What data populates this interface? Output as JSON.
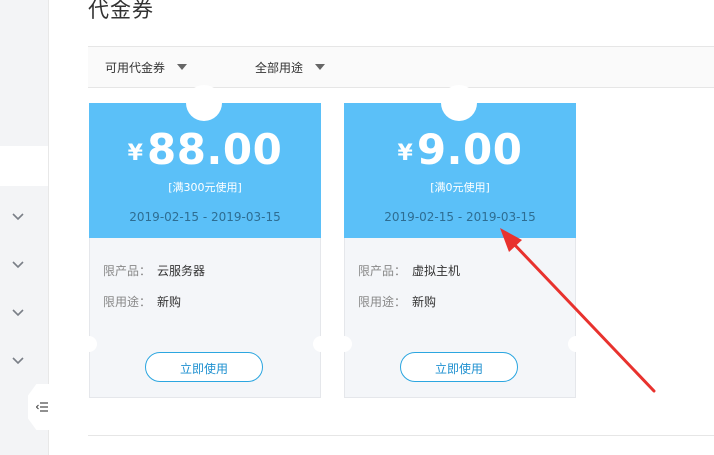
{
  "page": {
    "title": "代金券"
  },
  "filters": [
    {
      "label": "可用代金券"
    },
    {
      "label": "全部用途"
    }
  ],
  "coupons": [
    {
      "currency": "¥",
      "amount": "88.00",
      "condition": "[满300元使用]",
      "dates": "2019-02-15 - 2019-03-15",
      "product_label": "限产品：",
      "product": "云服务器",
      "usage_label": "限用途：",
      "usage": "新购",
      "button": "立即使用"
    },
    {
      "currency": "¥",
      "amount": "9.00",
      "condition": "[满0元使用]",
      "dates": "2019-02-15 - 2019-03-15",
      "product_label": "限产品：",
      "product": "虚拟主机",
      "usage_label": "限用途：",
      "usage": "新购",
      "button": "立即使用"
    }
  ],
  "sidebar": {
    "icons": [
      "chevron-down-icon",
      "chevron-down-icon",
      "chevron-down-icon",
      "chevron-down-icon",
      "collapse-menu-icon"
    ]
  },
  "colors": {
    "coupon_top": "#5bc0f8",
    "coupon_body": "#f4f6f9",
    "button_border": "#2ca6e0",
    "annotation_arrow": "#e8322e"
  }
}
